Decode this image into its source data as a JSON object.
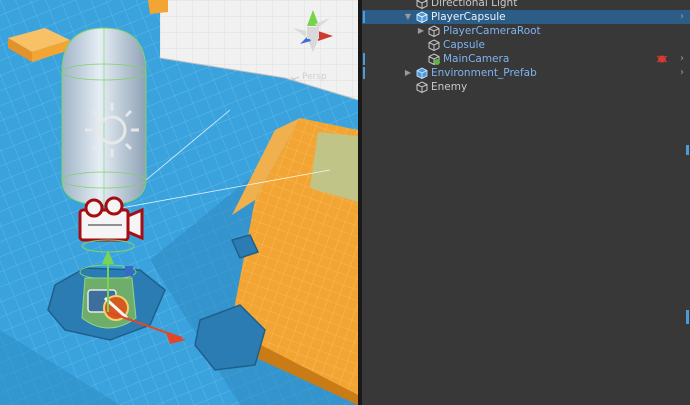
{
  "scene_view": {
    "persp_label": "Persp"
  },
  "hierarchy": {
    "rows": [
      {
        "label": "Directional Light"
      },
      {
        "label": "PlayerCapsule"
      },
      {
        "label": "PlayerCameraRoot"
      },
      {
        "label": "Capsule"
      },
      {
        "label": "MainCamera"
      },
      {
        "label": "Environment_Prefab"
      },
      {
        "label": "Enemy"
      }
    ]
  },
  "colors": {
    "selection": "#2c5d87",
    "prefab_text": "#7fb4f0",
    "panel_bg": "#383838",
    "ground_blue": "#3aa3dd",
    "cube_orange": "#f3a533"
  }
}
